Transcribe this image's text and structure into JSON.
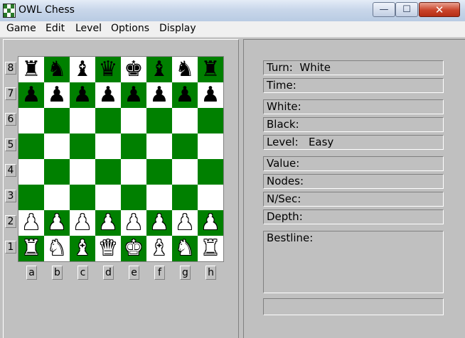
{
  "window": {
    "title": "OWL Chess",
    "controls": {
      "minimize": "—",
      "maximize": "☐",
      "close": "✕"
    }
  },
  "menu": [
    "Game",
    "Edit",
    "Level",
    "Options",
    "Display"
  ],
  "board": {
    "ranks": [
      "8",
      "7",
      "6",
      "5",
      "4",
      "3",
      "2",
      "1"
    ],
    "files": [
      "a",
      "b",
      "c",
      "d",
      "e",
      "f",
      "g",
      "h"
    ],
    "rows": [
      [
        "bR",
        "bN",
        "bB",
        "bQ",
        "bK",
        "bB",
        "bN",
        "bR"
      ],
      [
        "bP",
        "bP",
        "bP",
        "bP",
        "bP",
        "bP",
        "bP",
        "bP"
      ],
      [
        "",
        "",
        "",
        "",
        "",
        "",
        "",
        ""
      ],
      [
        "",
        "",
        "",
        "",
        "",
        "",
        "",
        ""
      ],
      [
        "",
        "",
        "",
        "",
        "",
        "",
        "",
        ""
      ],
      [
        "",
        "",
        "",
        "",
        "",
        "",
        "",
        ""
      ],
      [
        "wP",
        "wP",
        "wP",
        "wP",
        "wP",
        "wP",
        "wP",
        "wP"
      ],
      [
        "wR",
        "wN",
        "wB",
        "wQ",
        "wK",
        "wB",
        "wN",
        "wR"
      ]
    ],
    "colors": {
      "light": "#ffffff",
      "dark": "#008000"
    }
  },
  "info": {
    "turn": "Turn:  White",
    "time": "Time:",
    "white": "White:",
    "black": "Black:",
    "level": "Level:   Easy",
    "value": "Value:",
    "nodes": "Nodes:",
    "nsec": "N/Sec:",
    "depth": "Depth:",
    "bestline": "Bestline:"
  }
}
